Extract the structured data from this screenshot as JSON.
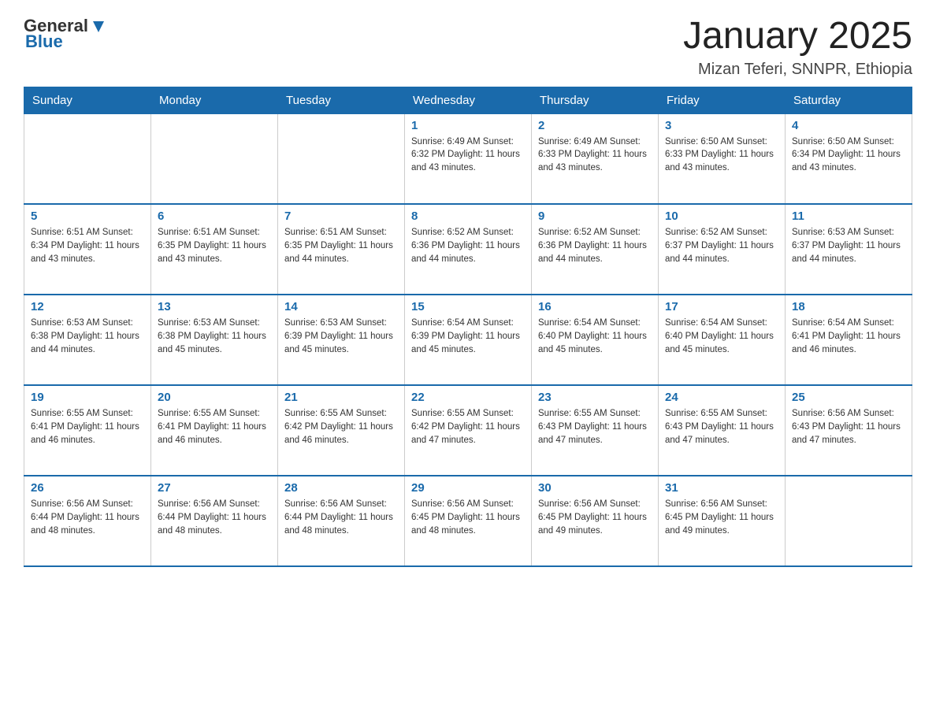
{
  "logo": {
    "general": "General",
    "blue": "Blue"
  },
  "header": {
    "title": "January 2025",
    "location": "Mizan Teferi, SNNPR, Ethiopia"
  },
  "weekdays": [
    "Sunday",
    "Monday",
    "Tuesday",
    "Wednesday",
    "Thursday",
    "Friday",
    "Saturday"
  ],
  "weeks": [
    [
      {
        "day": "",
        "info": ""
      },
      {
        "day": "",
        "info": ""
      },
      {
        "day": "",
        "info": ""
      },
      {
        "day": "1",
        "info": "Sunrise: 6:49 AM\nSunset: 6:32 PM\nDaylight: 11 hours and 43 minutes."
      },
      {
        "day": "2",
        "info": "Sunrise: 6:49 AM\nSunset: 6:33 PM\nDaylight: 11 hours and 43 minutes."
      },
      {
        "day": "3",
        "info": "Sunrise: 6:50 AM\nSunset: 6:33 PM\nDaylight: 11 hours and 43 minutes."
      },
      {
        "day": "4",
        "info": "Sunrise: 6:50 AM\nSunset: 6:34 PM\nDaylight: 11 hours and 43 minutes."
      }
    ],
    [
      {
        "day": "5",
        "info": "Sunrise: 6:51 AM\nSunset: 6:34 PM\nDaylight: 11 hours and 43 minutes."
      },
      {
        "day": "6",
        "info": "Sunrise: 6:51 AM\nSunset: 6:35 PM\nDaylight: 11 hours and 43 minutes."
      },
      {
        "day": "7",
        "info": "Sunrise: 6:51 AM\nSunset: 6:35 PM\nDaylight: 11 hours and 44 minutes."
      },
      {
        "day": "8",
        "info": "Sunrise: 6:52 AM\nSunset: 6:36 PM\nDaylight: 11 hours and 44 minutes."
      },
      {
        "day": "9",
        "info": "Sunrise: 6:52 AM\nSunset: 6:36 PM\nDaylight: 11 hours and 44 minutes."
      },
      {
        "day": "10",
        "info": "Sunrise: 6:52 AM\nSunset: 6:37 PM\nDaylight: 11 hours and 44 minutes."
      },
      {
        "day": "11",
        "info": "Sunrise: 6:53 AM\nSunset: 6:37 PM\nDaylight: 11 hours and 44 minutes."
      }
    ],
    [
      {
        "day": "12",
        "info": "Sunrise: 6:53 AM\nSunset: 6:38 PM\nDaylight: 11 hours and 44 minutes."
      },
      {
        "day": "13",
        "info": "Sunrise: 6:53 AM\nSunset: 6:38 PM\nDaylight: 11 hours and 45 minutes."
      },
      {
        "day": "14",
        "info": "Sunrise: 6:53 AM\nSunset: 6:39 PM\nDaylight: 11 hours and 45 minutes."
      },
      {
        "day": "15",
        "info": "Sunrise: 6:54 AM\nSunset: 6:39 PM\nDaylight: 11 hours and 45 minutes."
      },
      {
        "day": "16",
        "info": "Sunrise: 6:54 AM\nSunset: 6:40 PM\nDaylight: 11 hours and 45 minutes."
      },
      {
        "day": "17",
        "info": "Sunrise: 6:54 AM\nSunset: 6:40 PM\nDaylight: 11 hours and 45 minutes."
      },
      {
        "day": "18",
        "info": "Sunrise: 6:54 AM\nSunset: 6:41 PM\nDaylight: 11 hours and 46 minutes."
      }
    ],
    [
      {
        "day": "19",
        "info": "Sunrise: 6:55 AM\nSunset: 6:41 PM\nDaylight: 11 hours and 46 minutes."
      },
      {
        "day": "20",
        "info": "Sunrise: 6:55 AM\nSunset: 6:41 PM\nDaylight: 11 hours and 46 minutes."
      },
      {
        "day": "21",
        "info": "Sunrise: 6:55 AM\nSunset: 6:42 PM\nDaylight: 11 hours and 46 minutes."
      },
      {
        "day": "22",
        "info": "Sunrise: 6:55 AM\nSunset: 6:42 PM\nDaylight: 11 hours and 47 minutes."
      },
      {
        "day": "23",
        "info": "Sunrise: 6:55 AM\nSunset: 6:43 PM\nDaylight: 11 hours and 47 minutes."
      },
      {
        "day": "24",
        "info": "Sunrise: 6:55 AM\nSunset: 6:43 PM\nDaylight: 11 hours and 47 minutes."
      },
      {
        "day": "25",
        "info": "Sunrise: 6:56 AM\nSunset: 6:43 PM\nDaylight: 11 hours and 47 minutes."
      }
    ],
    [
      {
        "day": "26",
        "info": "Sunrise: 6:56 AM\nSunset: 6:44 PM\nDaylight: 11 hours and 48 minutes."
      },
      {
        "day": "27",
        "info": "Sunrise: 6:56 AM\nSunset: 6:44 PM\nDaylight: 11 hours and 48 minutes."
      },
      {
        "day": "28",
        "info": "Sunrise: 6:56 AM\nSunset: 6:44 PM\nDaylight: 11 hours and 48 minutes."
      },
      {
        "day": "29",
        "info": "Sunrise: 6:56 AM\nSunset: 6:45 PM\nDaylight: 11 hours and 48 minutes."
      },
      {
        "day": "30",
        "info": "Sunrise: 6:56 AM\nSunset: 6:45 PM\nDaylight: 11 hours and 49 minutes."
      },
      {
        "day": "31",
        "info": "Sunrise: 6:56 AM\nSunset: 6:45 PM\nDaylight: 11 hours and 49 minutes."
      },
      {
        "day": "",
        "info": ""
      }
    ]
  ]
}
